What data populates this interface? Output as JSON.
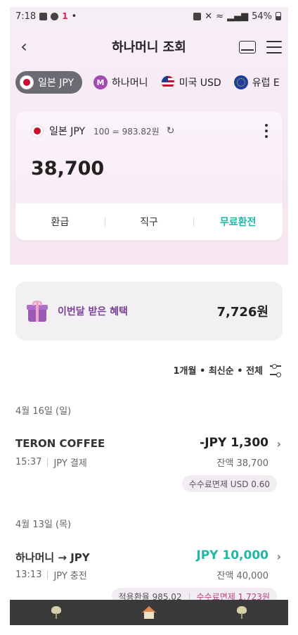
{
  "status_bar": {
    "time": "7:18",
    "battery": "54%",
    "logo": "1"
  },
  "header": {
    "title": "하나머니 조회"
  },
  "tabs": [
    {
      "label": "일본 JPY",
      "flag": "jp"
    },
    {
      "label": "하나머니",
      "flag": "m"
    },
    {
      "label": "미국 USD",
      "flag": "us"
    },
    {
      "label": "유럽 E",
      "flag": "eu"
    }
  ],
  "tab_m_letter": "M",
  "balance": {
    "currency": "일본 JPY",
    "rate": "100 = 983.82원",
    "amount": "38,700",
    "actions": [
      "환급",
      "직구",
      "무료환전"
    ]
  },
  "benefit": {
    "label": "이번달 받은 혜택",
    "value": "7,726원"
  },
  "filter": {
    "label": "1개월 • 최신순 • 전체"
  },
  "groups": [
    {
      "date": "4월 16일 (일)",
      "tx": {
        "name": "TERON COFFEE",
        "time": "15:37",
        "type": "JPY 결제",
        "amount": "-JPY 1,300",
        "balance": "잔액 38,700",
        "tag": "수수료면제 USD 0.60"
      }
    },
    {
      "date": "4월 13일 (목)",
      "tx": {
        "name": "하나머니 → JPY",
        "time": "13:13",
        "type": "JPY 충전",
        "amount": "JPY 10,000",
        "balance": "잔액 40,000",
        "tag_left": "적용환율 985.02",
        "tag_right": "수수료면제 1,723원"
      }
    }
  ],
  "colors": {
    "accent": "#1fb7a6",
    "purple": "#7b3f98",
    "pink": "#c0437a"
  }
}
